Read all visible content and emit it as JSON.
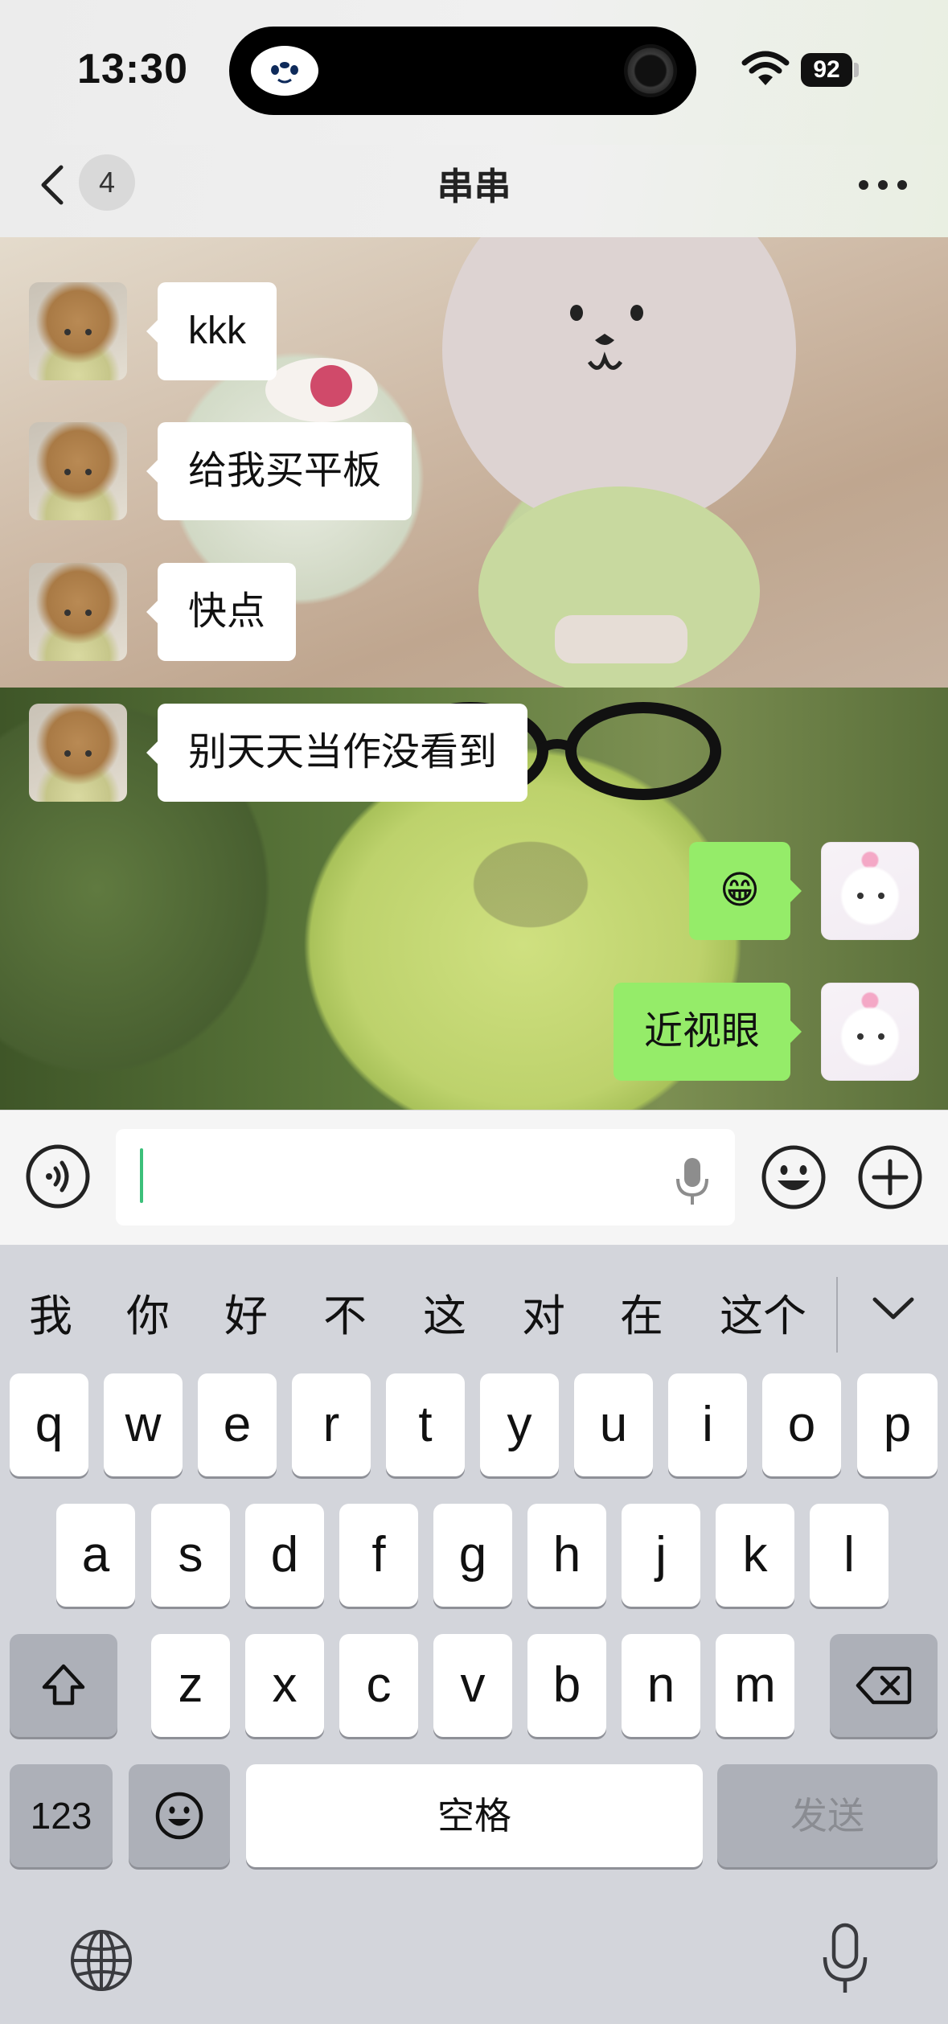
{
  "status_bar": {
    "time": "13:30",
    "battery": "92"
  },
  "nav": {
    "unread_count": "4",
    "title": "串串"
  },
  "messages": [
    {
      "side": "left",
      "text": "kkk"
    },
    {
      "side": "left",
      "text": "给我买平板"
    },
    {
      "side": "left",
      "text": "快点"
    },
    {
      "side": "left",
      "text": "别天天当作没看到"
    },
    {
      "side": "right",
      "text": "😁"
    },
    {
      "side": "right",
      "text": "近视眼"
    }
  ],
  "input": {
    "value": ""
  },
  "keyboard": {
    "candidates": [
      "我",
      "你",
      "好",
      "不",
      "这",
      "对",
      "在",
      "这个"
    ],
    "row1": [
      "q",
      "w",
      "e",
      "r",
      "t",
      "y",
      "u",
      "i",
      "o",
      "p"
    ],
    "row2": [
      "a",
      "s",
      "d",
      "f",
      "g",
      "h",
      "j",
      "k",
      "l"
    ],
    "row3": [
      "z",
      "x",
      "c",
      "v",
      "b",
      "n",
      "m"
    ],
    "numbers_key": "123",
    "space_key": "空格",
    "send_key": "发送"
  },
  "icons": {
    "back": "chevron-left-icon",
    "more": "more-dots-icon",
    "voice": "voice-input-icon",
    "mic": "microphone-icon",
    "emoji": "emoji-icon",
    "plus": "plus-icon",
    "shift": "shift-icon",
    "backspace": "backspace-icon",
    "globe": "globe-icon"
  },
  "colors": {
    "sent_bubble": "#95ec69",
    "received_bubble": "#ffffff",
    "caret": "#3cc07a"
  }
}
